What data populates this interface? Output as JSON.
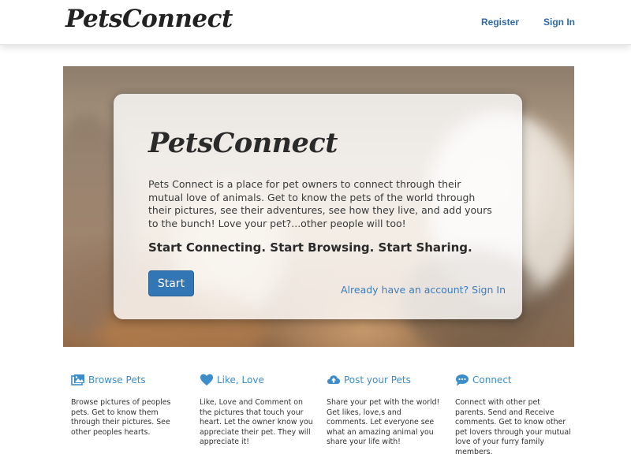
{
  "navbar": {
    "brand": "PetsConnect",
    "register_label": "Register",
    "signin_label": "Sign In"
  },
  "hero": {
    "logo": "PetsConnect",
    "description": "Pets Connect is a place for pet owners to connect through their mutual love of animals. Get to know the pets of the world through their pictures, see their adventures, see how they live, and add yours to the bunch! Love your pet?...other people will too!",
    "tagline": "Start Connecting. Start Browsing. Start Sharing.",
    "start_label": "Start",
    "account_link": "Already have an account? Sign In"
  },
  "features": [
    {
      "icon": "images-icon",
      "title": "Browse Pets",
      "text": "Browse pictures of peoples pets. Get to know them through their pictures. See other peoples hearts."
    },
    {
      "icon": "heart-icon",
      "title": "Like, Love",
      "text": "Like, Love and Comment on the pictures that touch your heart. Let the owner know you appreciate their pet. They will appreciate it!"
    },
    {
      "icon": "cloud-upload-icon",
      "title": "Post your Pets",
      "text": "Share your pet with the world! Get likes, love,s and comments. Let everyone see what an amazing animal you share your life with!"
    },
    {
      "icon": "chat-icon",
      "title": "Connect",
      "text": "Connect with other pet parents. Send and Receive comments. Get to know other pet lovers through your mutual love of your furry family members."
    }
  ],
  "colors": {
    "link": "#2f6aa8",
    "accent": "#3c8dc8",
    "button": "#3276b6"
  }
}
